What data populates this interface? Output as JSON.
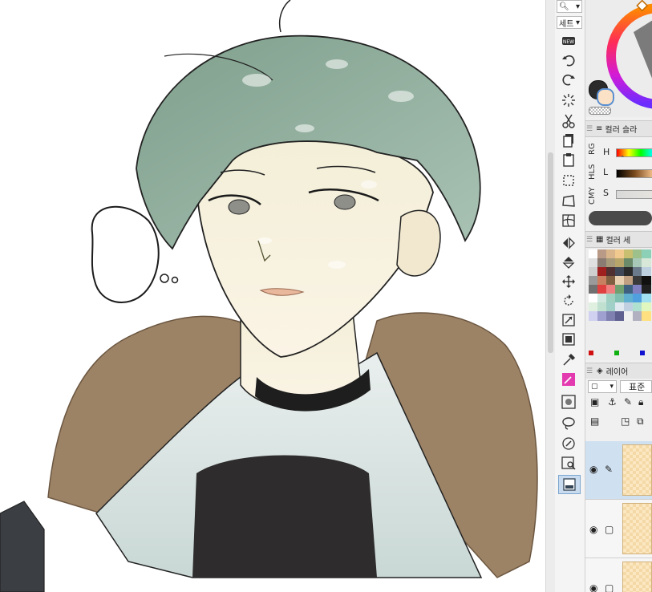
{
  "toolbar": {
    "zoom_icon": "magnifier-icon",
    "set_label": "세트"
  },
  "color_slider_panel": {
    "title": "컬러 슬라",
    "tabs": [
      "RG",
      "HLS",
      "CMY"
    ],
    "sliders": [
      {
        "label": "H"
      },
      {
        "label": "L"
      },
      {
        "label": "S"
      }
    ]
  },
  "color_set_panel": {
    "title": "컬러 세"
  },
  "layer_panel": {
    "title": "레이어",
    "blend_mode": "표준"
  },
  "colors": {
    "main_color": "#2b2b2b",
    "sub_color": "#ffffff",
    "selection_blue": "#cfe0f1",
    "layer_thumbnail": "#fbe7c2"
  }
}
